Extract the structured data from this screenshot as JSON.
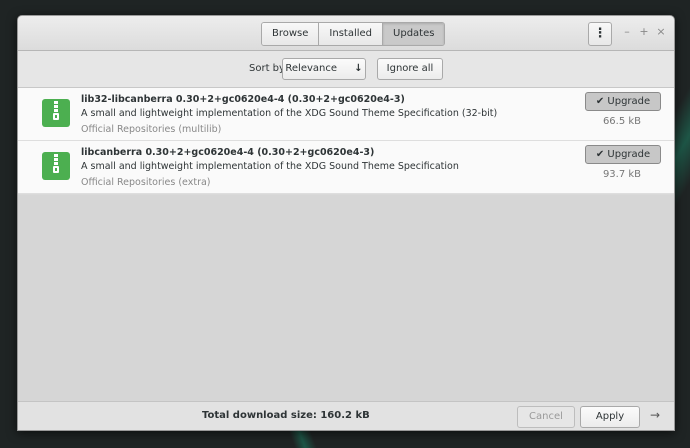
{
  "tabs": [
    {
      "label": "Browse"
    },
    {
      "label": "Installed"
    },
    {
      "label": "Updates"
    }
  ],
  "header": {
    "menu_icon": "vertical-dots-icon",
    "minimize": "–",
    "maximize": "+",
    "close": "×"
  },
  "toolbar": {
    "sort_by_label": "Sort by",
    "sort_value": "Relevance",
    "sort_arrow": "↓",
    "ignore_all_label": "Ignore all"
  },
  "packages": [
    {
      "name_line": "lib32-libcanberra  0.30+2+gc0620e4-4  (0.30+2+gc0620e4-3)",
      "description": "A small and lightweight implementation of the XDG Sound Theme Specification (32-bit)",
      "repository": "Official Repositories (multilib)",
      "upgrade_label": "Upgrade",
      "size": "66.5 kB"
    },
    {
      "name_line": "libcanberra  0.30+2+gc0620e4-4  (0.30+2+gc0620e4-3)",
      "description": "A small and lightweight implementation of the XDG Sound Theme Specification",
      "repository": "Official Repositories (extra)",
      "upgrade_label": "Upgrade",
      "size": "93.7 kB"
    }
  ],
  "footer": {
    "total_download": "Total download size: 160.2 kB",
    "cancel_label": "Cancel",
    "apply_label": "Apply",
    "arrow": "→"
  },
  "colors": {
    "package_icon_green": "#4caf50",
    "active_tab": "#c9c9c9"
  }
}
